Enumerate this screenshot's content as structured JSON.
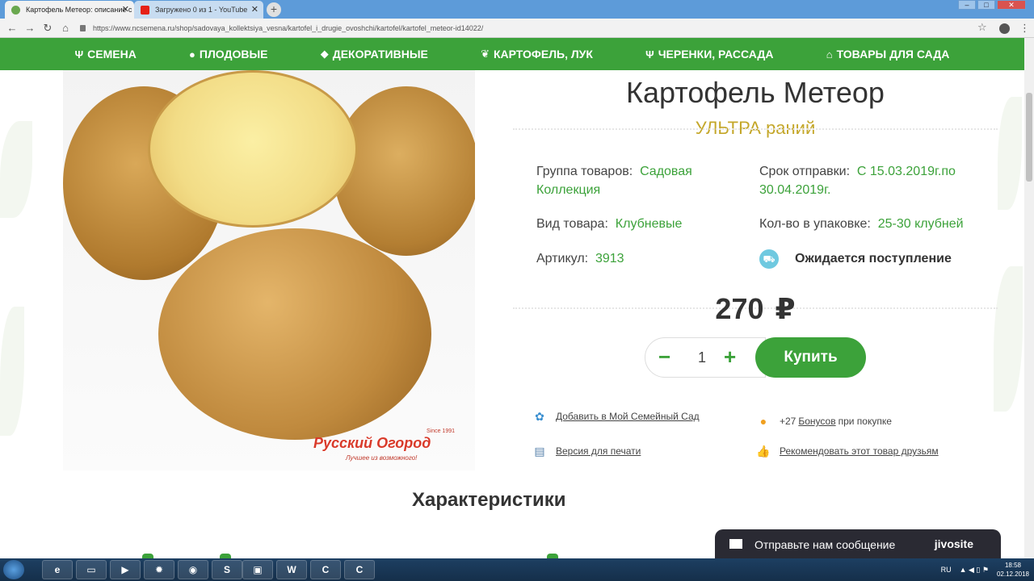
{
  "browser": {
    "tabs": [
      {
        "title": "Картофель Метеор: описание с",
        "active": true
      },
      {
        "title": "Загружено 0 из 1 - YouTube",
        "active": false
      }
    ],
    "url": "https://www.ncsemena.ru/shop/sadovaya_kollektsiya_vesna/kartofel_i_drugie_ovoshchi/kartofel/kartofel_meteor-id14022/"
  },
  "nav": {
    "items": [
      {
        "label": "СЕМЕНА",
        "icon": "sprout-icon"
      },
      {
        "label": "ПЛОДОВЫЕ",
        "icon": "apple-icon"
      },
      {
        "label": "ДЕКОРАТИВНЫЕ",
        "icon": "flower-icon"
      },
      {
        "label": "КАРТОФЕЛЬ, ЛУК",
        "icon": "leaf-icon"
      },
      {
        "label": "ЧЕРЕНКИ, РАССАДА",
        "icon": "seedling-icon"
      },
      {
        "label": "ТОВАРЫ ДЛЯ САДА",
        "icon": "house-icon"
      }
    ]
  },
  "image": {
    "brand_name": "Русский Огород",
    "brand_since": "Since 1991",
    "brand_slogan": "Лучшее из возможного!"
  },
  "product": {
    "title": "Картофель Метеор",
    "subtitle": "УЛЬТРА раний",
    "group_label": "Группа товаров:",
    "group_value": "Садовая Коллекция",
    "ship_label": "Срок отправки:",
    "ship_value": "С 15.03.2019г.по 30.04.2019г.",
    "type_label": "Вид товара:",
    "type_value": "Клубневые",
    "pack_label": "Кол-во в упаковке:",
    "pack_value": "25-30 клубней",
    "sku_label": "Артикул:",
    "sku_value": "3913",
    "availability": "Ожидается поступление",
    "price": "270",
    "currency": "₽",
    "quantity": "1",
    "buy_label": "Купить"
  },
  "links": {
    "family_garden": "Добавить в Мой Семейный Сад",
    "bonus_prefix": "+27",
    "bonus_link": "Бонусов",
    "bonus_suffix": "при покупке",
    "print": "Версия для печати",
    "recommend": "Рекомендовать этот товар друзьям"
  },
  "section": {
    "title": "Характеристики"
  },
  "chat": {
    "text": "Отправьте нам сообщение",
    "brand": "jivosite"
  },
  "taskbar": {
    "lang": "RU",
    "time": "18:58",
    "date": "02.12.2018"
  }
}
